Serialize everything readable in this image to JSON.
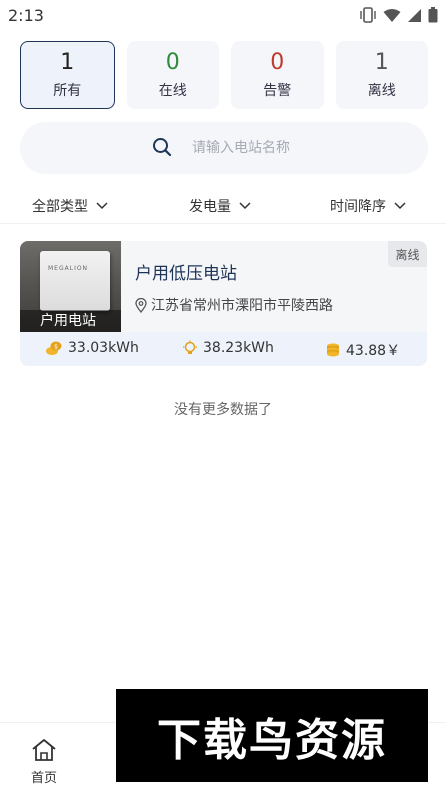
{
  "status_bar": {
    "time": "2:13"
  },
  "tabs": [
    {
      "count": "1",
      "label": "所有",
      "color": "#222222",
      "active": true
    },
    {
      "count": "0",
      "label": "在线",
      "color": "#2e8b3a",
      "active": false
    },
    {
      "count": "0",
      "label": "告警",
      "color": "#c0392b",
      "active": false
    },
    {
      "count": "1",
      "label": "离线",
      "color": "#555555",
      "active": false
    }
  ],
  "search": {
    "placeholder": "请输入电站名称"
  },
  "sorts": [
    {
      "label": "全部类型"
    },
    {
      "label": "发电量"
    },
    {
      "label": "时间降序"
    }
  ],
  "station": {
    "name": "户用低压电站",
    "address": "江苏省常州市溧阳市平陵西路",
    "status": "离线",
    "image_label": "户用电站",
    "device_brand": "MEGALION",
    "stats": {
      "energy": "33.03kWh",
      "power": "38.23kWh",
      "income": "43.88￥"
    }
  },
  "list_footer": "没有更多数据了",
  "bottom_nav": {
    "home": "首页"
  },
  "watermark": "下载鸟资源",
  "colors": {
    "accent": "#1f3558",
    "stat_icon": "#e3a21a"
  }
}
